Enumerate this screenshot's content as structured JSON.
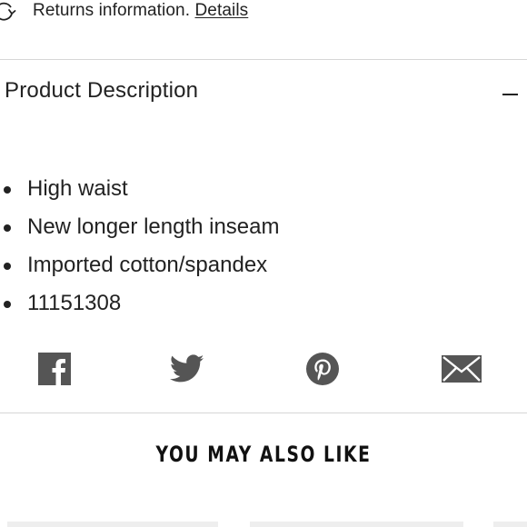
{
  "returns": {
    "text": "Returns information.",
    "link_label": "Details",
    "icon": "refresh-icon"
  },
  "product_description": {
    "title": "Product Description",
    "toggle_icon": "minus-icon",
    "bullets": [
      "High waist",
      "New longer length inseam",
      "Imported cotton/spandex",
      "11151308"
    ]
  },
  "share": {
    "icons": [
      "facebook-icon",
      "twitter-icon",
      "pinterest-icon",
      "mail-icon"
    ],
    "icon_color": "#555555"
  },
  "recommendations": {
    "title": "YOU MAY ALSO LIKE"
  }
}
